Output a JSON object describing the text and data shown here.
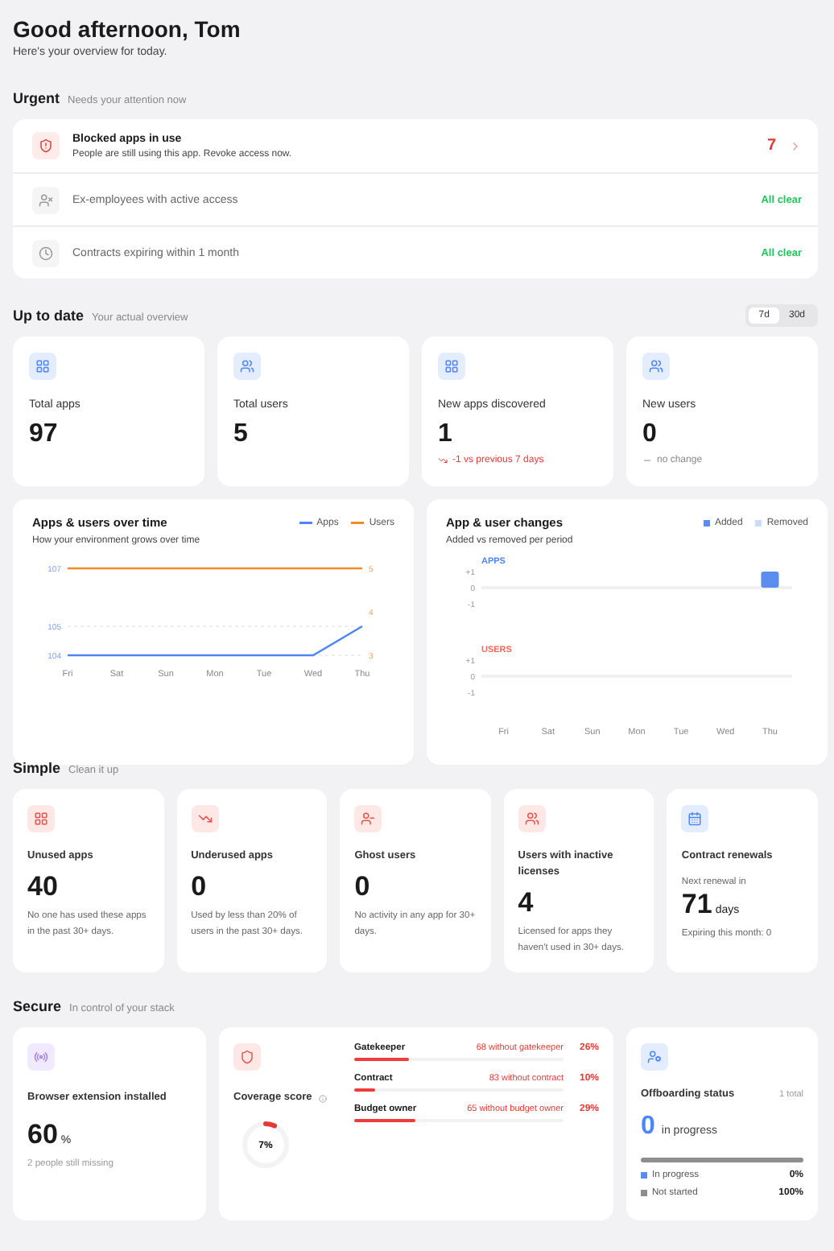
{
  "header": {
    "title": "Good afternoon, Tom",
    "subtitle": "Here's your overview for today."
  },
  "urgent": {
    "title": "Urgent",
    "subtitle": "Needs your attention now",
    "rows": [
      {
        "kind": "alert",
        "title": "Blocked apps in use",
        "description": "People are still using this app. Revoke access now.",
        "count": "7"
      },
      {
        "kind": "clear",
        "title": "Ex-employees with active access",
        "status": "All clear"
      },
      {
        "kind": "clear",
        "title": "Contracts expiring within 1 month",
        "status": "All clear"
      }
    ]
  },
  "up_to_date": {
    "title": "Up to date",
    "subtitle": "Your actual overview",
    "periods": [
      {
        "label": "7d",
        "selected": true
      },
      {
        "label": "30d",
        "selected": false
      }
    ],
    "stats": [
      {
        "label": "Total apps",
        "value": "97"
      },
      {
        "label": "Total users",
        "value": "5"
      },
      {
        "label": "New apps discovered",
        "value": "1",
        "delta": "-1 vs previous 7 days",
        "kind": "down"
      },
      {
        "label": "New users",
        "value": "0",
        "delta": "no change",
        "kind": "flat"
      }
    ],
    "growth": {
      "title": "Apps & users over time",
      "subtitle": "How your environment grows over time",
      "axes": [
        {
          "chart_data": {
            "type": "line",
            "categories": [
              "Fri",
              "Sat",
              "Sun",
              "Mon",
              "Tue",
              "Wed",
              "Thu"
            ],
            "series": [
              {
                "name": "Apps",
                "color": "#4f86f7",
                "values": [
                  104,
                  104,
                  104,
                  104,
                  104,
                  104,
                  105
                ]
              }
            ],
            "ylim": [
              104,
              107
            ],
            "yticks": [
              104,
              105,
              107
            ]
          }
        },
        {
          "chart_data": {
            "type": "line",
            "series": [
              {
                "name": "Users",
                "color": "#f28c28",
                "values": [
                  5,
                  5,
                  5,
                  5,
                  5,
                  5,
                  5
                ]
              }
            ],
            "ylim": [
              3,
              5
            ],
            "yticks": [
              3,
              4,
              5
            ]
          }
        }
      ]
    },
    "changes": {
      "title": "App & user changes",
      "subtitle": "Added vs removed per period",
      "legend": [
        {
          "name": "Added",
          "color": "#5b8def"
        },
        {
          "name": "Removed",
          "color": "#c9dcfb"
        }
      ],
      "panels": [
        {
          "label": "APPS",
          "color": "#4f86f7",
          "chart_data": {
            "type": "bar",
            "series": [
              {
                "color": "#5b8def",
                "values": [
                  0,
                  0,
                  0,
                  0,
                  0,
                  0,
                  1
                ]
              },
              {
                "color": "#c9dcfb",
                "values": [
                  0,
                  0,
                  0,
                  0,
                  0,
                  0,
                  0
                ]
              }
            ],
            "ylim": [
              -1,
              1
            ],
            "yticks": [
              {
                "value": 1,
                "label": "+1"
              },
              {
                "value": 0,
                "label": "0"
              },
              {
                "value": -1,
                "label": "-1"
              }
            ]
          }
        },
        {
          "label": "USERS",
          "color": "#f06a5a",
          "chart_data": {
            "type": "bar",
            "categories": [
              "Fri",
              "Sat",
              "Sun",
              "Mon",
              "Tue",
              "Wed",
              "Thu"
            ],
            "series": [
              {
                "color": "#5b8def",
                "values": [
                  0,
                  0,
                  0,
                  0,
                  0,
                  0,
                  0
                ]
              },
              {
                "color": "#c9dcfb",
                "values": [
                  0,
                  0,
                  0,
                  0,
                  0,
                  0,
                  0
                ]
              }
            ],
            "ylim": [
              -1,
              1
            ],
            "yticks": [
              {
                "value": 1,
                "label": "+1"
              },
              {
                "value": 0,
                "label": "0"
              },
              {
                "value": -1,
                "label": "-1"
              }
            ]
          }
        }
      ]
    }
  },
  "simple": {
    "title": "Simple",
    "subtitle": "Clean it up",
    "cards": [
      {
        "kind": "metric",
        "title": "Unused apps",
        "value": "40",
        "description": "No one has used these apps in the past 30+ days."
      },
      {
        "kind": "metric",
        "title": "Underused apps",
        "value": "0",
        "description": "Used by less than 20% of users in the past 30+ days."
      },
      {
        "kind": "metric",
        "title": "Ghost users",
        "value": "0",
        "description": "No activity in any app for 30+ days."
      },
      {
        "kind": "metric",
        "title": "Users with inactive licenses",
        "value": "4",
        "description": "Licensed for apps they haven't used in 30+ days."
      },
      {
        "kind": "renewal",
        "title": "Contract renewals",
        "caption": "Next renewal in",
        "value": "71",
        "unit": "days",
        "description": "Expiring this month: 0"
      }
    ]
  },
  "secure": {
    "title": "Secure",
    "subtitle": "In control of your stack",
    "browser_extension": {
      "title": "Browser extension installed",
      "value": "60",
      "unit": "%",
      "note": "2 people still missing"
    },
    "coverage": {
      "title": "Coverage score",
      "score": "7%",
      "rows": [
        {
          "label": "Gatekeeper",
          "missing": "68 without gatekeeper",
          "percent": "26%",
          "level": 0.26
        },
        {
          "label": "Contract",
          "missing": "83 without contract",
          "percent": "10%",
          "level": 0.1
        },
        {
          "label": "Budget owner",
          "missing": "65 without budget owner",
          "percent": "29%",
          "level": 0.29
        }
      ]
    },
    "offboarding": {
      "title": "Offboarding status",
      "total": "1 total",
      "value": "0",
      "value_label": "in progress",
      "legend": [
        {
          "label": "In progress",
          "color": "#5b8def",
          "percent": "0%",
          "level": 0
        },
        {
          "label": "Not started",
          "color": "#8e8e8e",
          "percent": "100%",
          "level": 1
        }
      ]
    }
  }
}
